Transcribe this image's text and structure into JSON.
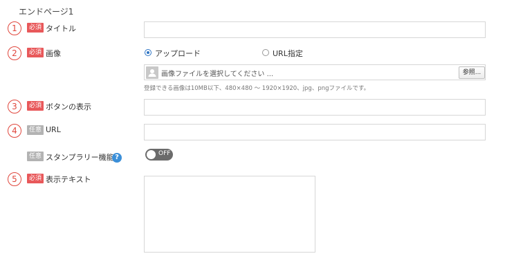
{
  "page": {
    "section_title": "エンドページ1"
  },
  "fields": {
    "title": {
      "number": "1",
      "badge": "必須",
      "label": "タイトル",
      "value": ""
    },
    "image": {
      "number": "2",
      "badge": "必須",
      "label": "画像",
      "options": [
        {
          "label": "アップロード",
          "selected": true
        },
        {
          "label": "URL指定",
          "selected": false
        }
      ],
      "file_placeholder": "画像ファイルを選択してください ...",
      "browse_label": "参照...",
      "hint": "登録できる画像は10MB以下、480×480 ～ 1920×1920、jpg、pngファイルです。"
    },
    "button_label": {
      "number": "3",
      "badge": "必須",
      "label": "ボタンの表示",
      "value": ""
    },
    "url": {
      "number": "4",
      "badge": "任意",
      "label": "URL",
      "value": ""
    },
    "stamp_rally": {
      "badge": "任意",
      "label": "スタンプラリー機能",
      "help": "?",
      "toggle_label": "OFF",
      "enabled": false
    },
    "display_text": {
      "number": "5",
      "badge": "必須",
      "label": "表示テキスト",
      "value": ""
    }
  },
  "colors": {
    "required": "#e8585a",
    "optional": "#b3b3b3",
    "number": "#e0463c",
    "radio": "#2d74c4",
    "help": "#3b8fd8",
    "toggle_off": "#6b6b6b"
  },
  "icons": {
    "file": "user-placeholder-icon",
    "help": "question-icon"
  }
}
